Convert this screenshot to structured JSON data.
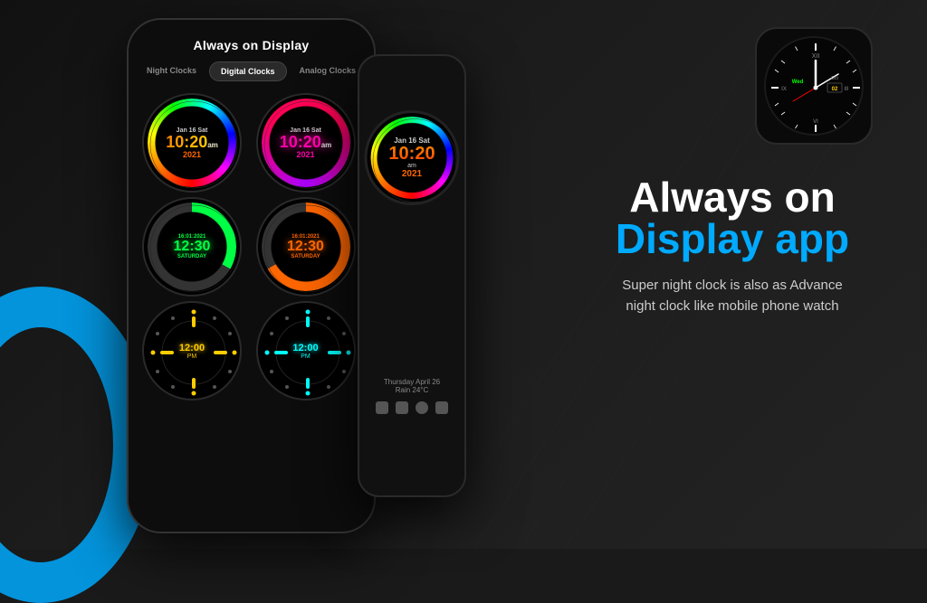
{
  "app": {
    "title": "Always on Display",
    "tabs": [
      {
        "id": "night",
        "label": "Night Clocks",
        "active": false
      },
      {
        "id": "digital",
        "label": "Digital Clocks",
        "active": true
      },
      {
        "id": "analog",
        "label": "Analog Clocks",
        "active": false
      }
    ]
  },
  "clocks": [
    {
      "id": 1,
      "type": "rainbow-ring",
      "date": "Jan 16 Sat",
      "time": "10:20",
      "ampm": "am",
      "year": "2021",
      "time_color": "rainbow"
    },
    {
      "id": 2,
      "type": "purple-ring",
      "date": "Jan 16 Sat",
      "time": "10:20",
      "ampm": "am",
      "year": "2021",
      "time_color": "purple"
    },
    {
      "id": 3,
      "type": "green-digital",
      "date": "16:01:2021",
      "day": "SATURDAY",
      "time": "12:30",
      "time_color": "green"
    },
    {
      "id": 4,
      "type": "orange-digital",
      "date": "16:01:2021",
      "day": "SATURDAY",
      "time": "12:30",
      "time_color": "orange"
    },
    {
      "id": 5,
      "type": "dots-yellow",
      "time": "12:00",
      "ampm": "PM",
      "dot_color": "yellow"
    },
    {
      "id": 6,
      "type": "dots-cyan",
      "time": "12:00",
      "ampm": "PM",
      "dot_color": "cyan"
    }
  ],
  "big_clock": {
    "date": "Jan 16 Sat",
    "time": "10:20",
    "ampm": "am",
    "year": "2021"
  },
  "weather": {
    "line1": "Thursday April 26",
    "line2": "Rain 24°C"
  },
  "headline": {
    "line1": "Always on",
    "line2": "Display app",
    "subtitle": "Super night clock is also as Advance\nnight clock like mobile phone watch"
  },
  "watch": {
    "day": "Wed",
    "month": "Oct",
    "date": "02"
  },
  "colors": {
    "accent_blue": "#00aaff",
    "background": "#1a1a1a",
    "text_white": "#ffffff",
    "text_gray": "#cccccc"
  }
}
